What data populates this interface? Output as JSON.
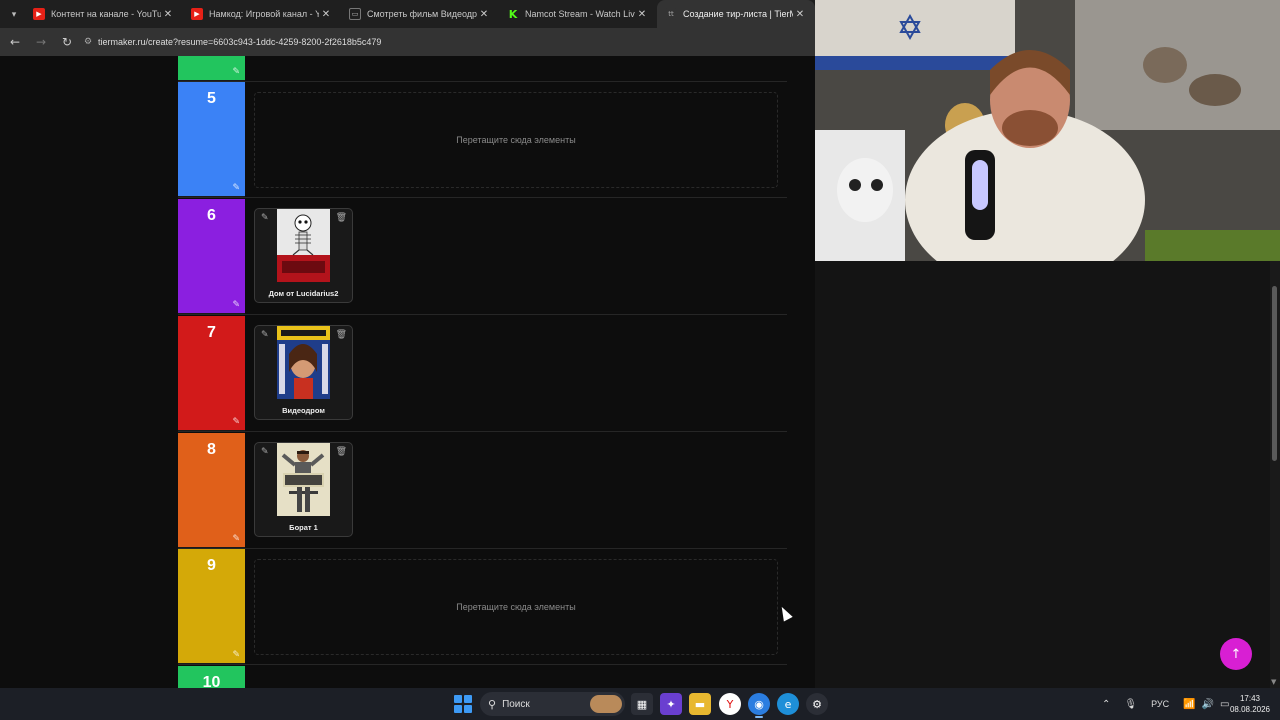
{
  "browser": {
    "tabs": [
      {
        "title": "Контент на канале - YouTube S",
        "icon": "youtube-icon",
        "active": false
      },
      {
        "title": "Намкод: Игровой канал - YouT",
        "icon": "youtube-icon",
        "active": false
      },
      {
        "title": "Смотреть фильм Видеодром о",
        "icon": "film-icon",
        "active": false
      },
      {
        "title": "Namcot Stream - Watch Live on",
        "icon": "kick-icon",
        "active": false
      },
      {
        "title": "Создание тир-листа | TierMak",
        "icon": "tiermaker-icon",
        "active": true
      }
    ],
    "url": "tiermaker.ru/create?resume=6603c943-1ddc-4259-8200-2f2618b5c479"
  },
  "tiers": [
    {
      "label": "",
      "color": "#22c55e",
      "items": []
    },
    {
      "label": "5",
      "color": "#3b82f6",
      "empty_text": "Перетащите сюда элементы",
      "items": []
    },
    {
      "label": "6",
      "color": "#8b1fe0",
      "items": [
        {
          "caption": "Дом от Lucidarius2"
        }
      ]
    },
    {
      "label": "7",
      "color": "#d21a1a",
      "items": [
        {
          "caption": "Видеодром"
        }
      ]
    },
    {
      "label": "8",
      "color": "#e0601a",
      "items": [
        {
          "caption": "Борат 1"
        }
      ]
    },
    {
      "label": "9",
      "color": "#d4a908",
      "empty_text": "Перетащите сюда элементы",
      "items": []
    },
    {
      "label": "10",
      "color": "#22c55e",
      "items": []
    }
  ],
  "taskbar": {
    "search_placeholder": "Поиск",
    "language": "РУС",
    "time": "17:43",
    "date": "08.08.2026"
  }
}
